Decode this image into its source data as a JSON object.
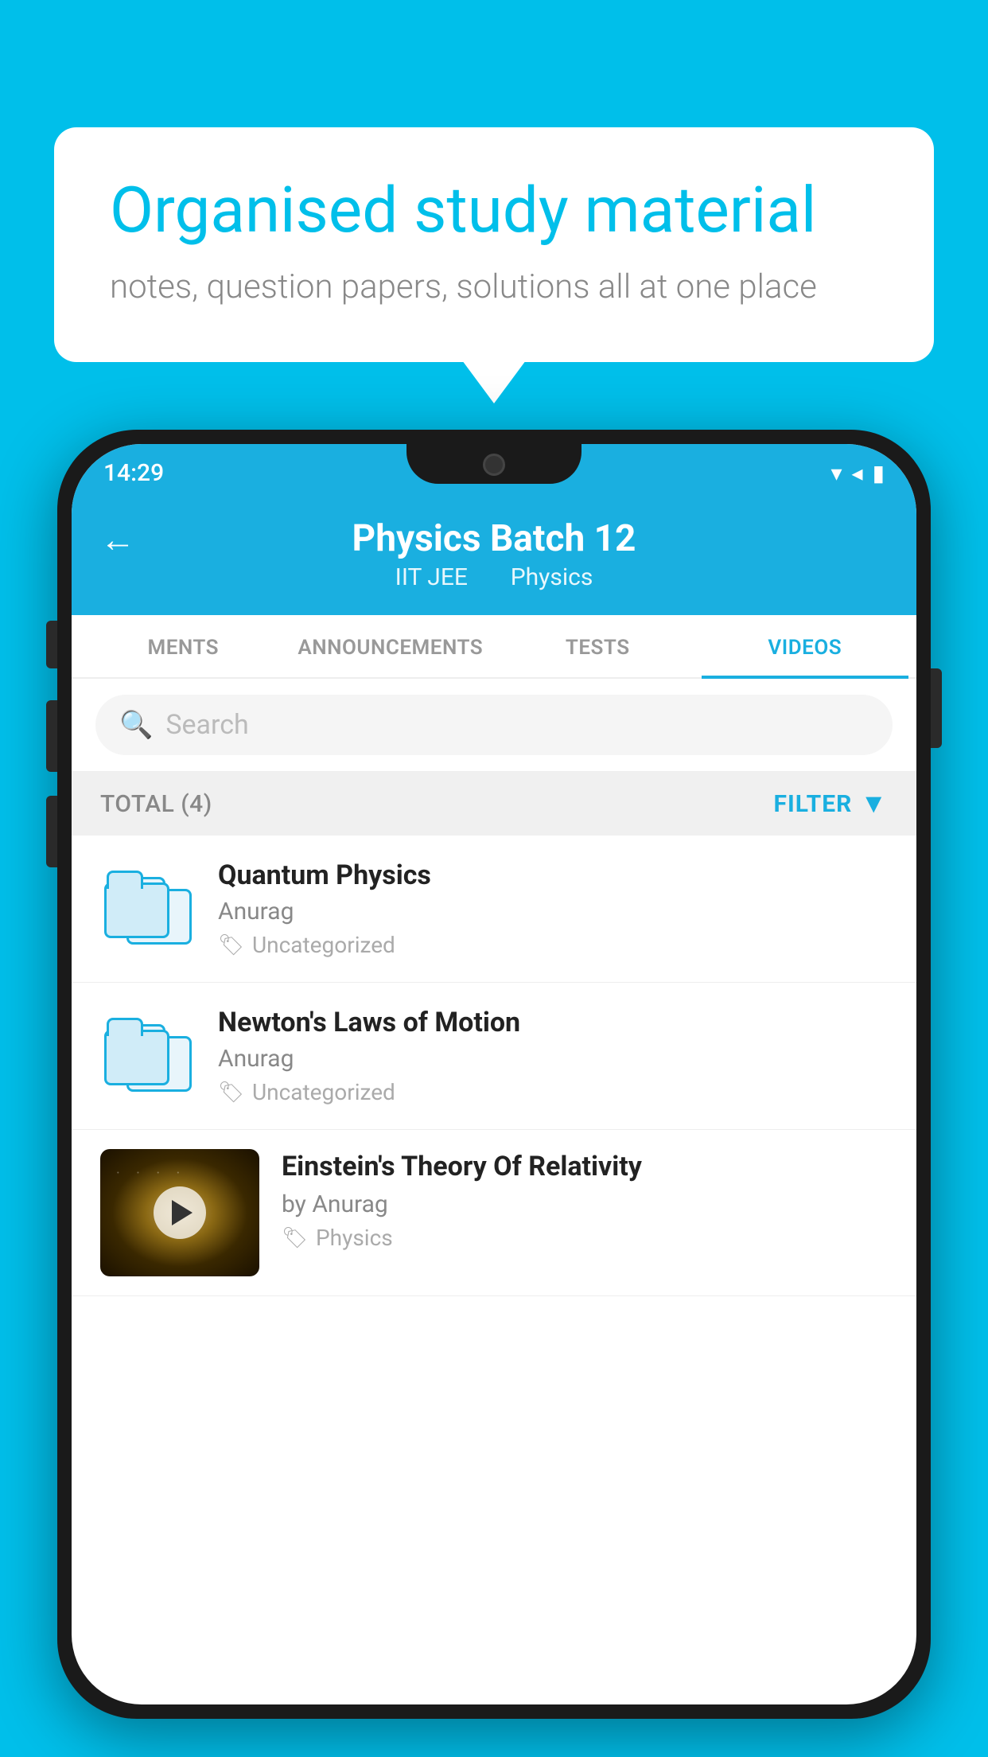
{
  "background_color": "#00BFEA",
  "speech_bubble": {
    "heading": "Organised study material",
    "subtext": "notes, question papers, solutions all at one place"
  },
  "phone": {
    "status_bar": {
      "time": "14:29",
      "icons": "▾◂▮"
    },
    "header": {
      "back_label": "←",
      "title": "Physics Batch 12",
      "subtitle_1": "IIT JEE",
      "subtitle_2": "Physics"
    },
    "tabs": [
      {
        "label": "MENTS",
        "active": false
      },
      {
        "label": "ANNOUNCEMENTS",
        "active": false
      },
      {
        "label": "TESTS",
        "active": false
      },
      {
        "label": "VIDEOS",
        "active": true
      }
    ],
    "search": {
      "placeholder": "Search"
    },
    "filter_bar": {
      "total_label": "TOTAL (4)",
      "filter_label": "FILTER"
    },
    "videos": [
      {
        "title": "Quantum Physics",
        "author": "Anurag",
        "tag": "Uncategorized",
        "has_thumb": false
      },
      {
        "title": "Newton's Laws of Motion",
        "author": "Anurag",
        "tag": "Uncategorized",
        "has_thumb": false
      },
      {
        "title": "Einstein's Theory Of Relativity",
        "author": "by Anurag",
        "tag": "Physics",
        "has_thumb": true
      }
    ]
  }
}
